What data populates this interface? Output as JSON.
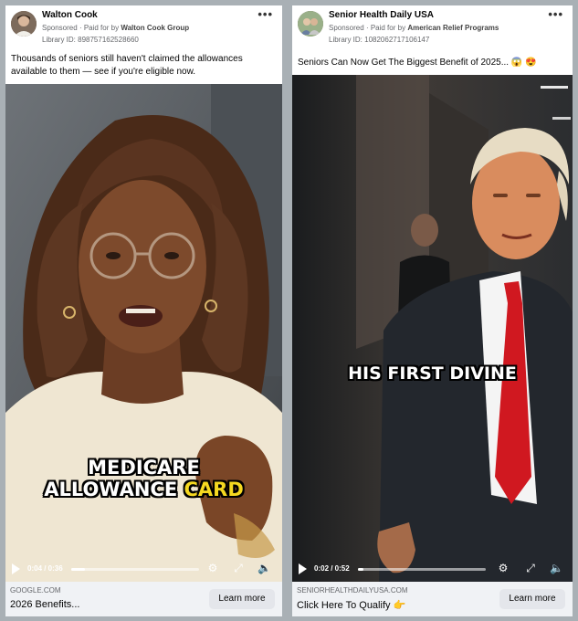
{
  "left_ad": {
    "advertiser": "Walton Cook",
    "sponsored": "Sponsored",
    "paid_for_prefix": "· Paid for by",
    "paid_for_by": "Walton Cook Group",
    "library_id": "Library ID: 898757162528660",
    "caption": "Thousands of seniors still haven't claimed the allowances available to them — see if you're eligible now.",
    "overlay_line1": "MEDICARE",
    "overlay_line2_white": "ALLOWANCE",
    "overlay_line2_yellow": "CARD",
    "time": "0:04 / 0:36",
    "progress": 0.11,
    "domain": "GOOGLE.COM",
    "title": "2026 Benefits...",
    "cta": "Learn more"
  },
  "right_ad": {
    "advertiser": "Senior Health Daily USA",
    "sponsored": "Sponsored",
    "paid_for_prefix": "· Paid for by",
    "paid_for_by": "American Relief Programs",
    "library_id": "Library ID: 1082062717106147",
    "caption": "Seniors Can Now Get The Biggest Benefit of 2025...",
    "caption_emojis": "😱 😍",
    "overlay_text": "HIS FIRST DIVINE",
    "time": "0:02 / 0:52",
    "progress": 0.04,
    "domain": "SENIORHEALTHDAILYUSA.COM",
    "title": "Click Here To Qualify",
    "title_emoji": "👉",
    "cta": "Learn more"
  },
  "icons": [
    "more-options-icon",
    "play-icon",
    "settings-icon",
    "fullscreen-icon",
    "volume-icon"
  ],
  "colors": {
    "page_bg": "#a9b0b5",
    "cta_bg": "#e4e6eb",
    "footer_bg": "#f0f2f5",
    "tie_red": "#d01820",
    "overlay_yellow": "#f5d820"
  }
}
